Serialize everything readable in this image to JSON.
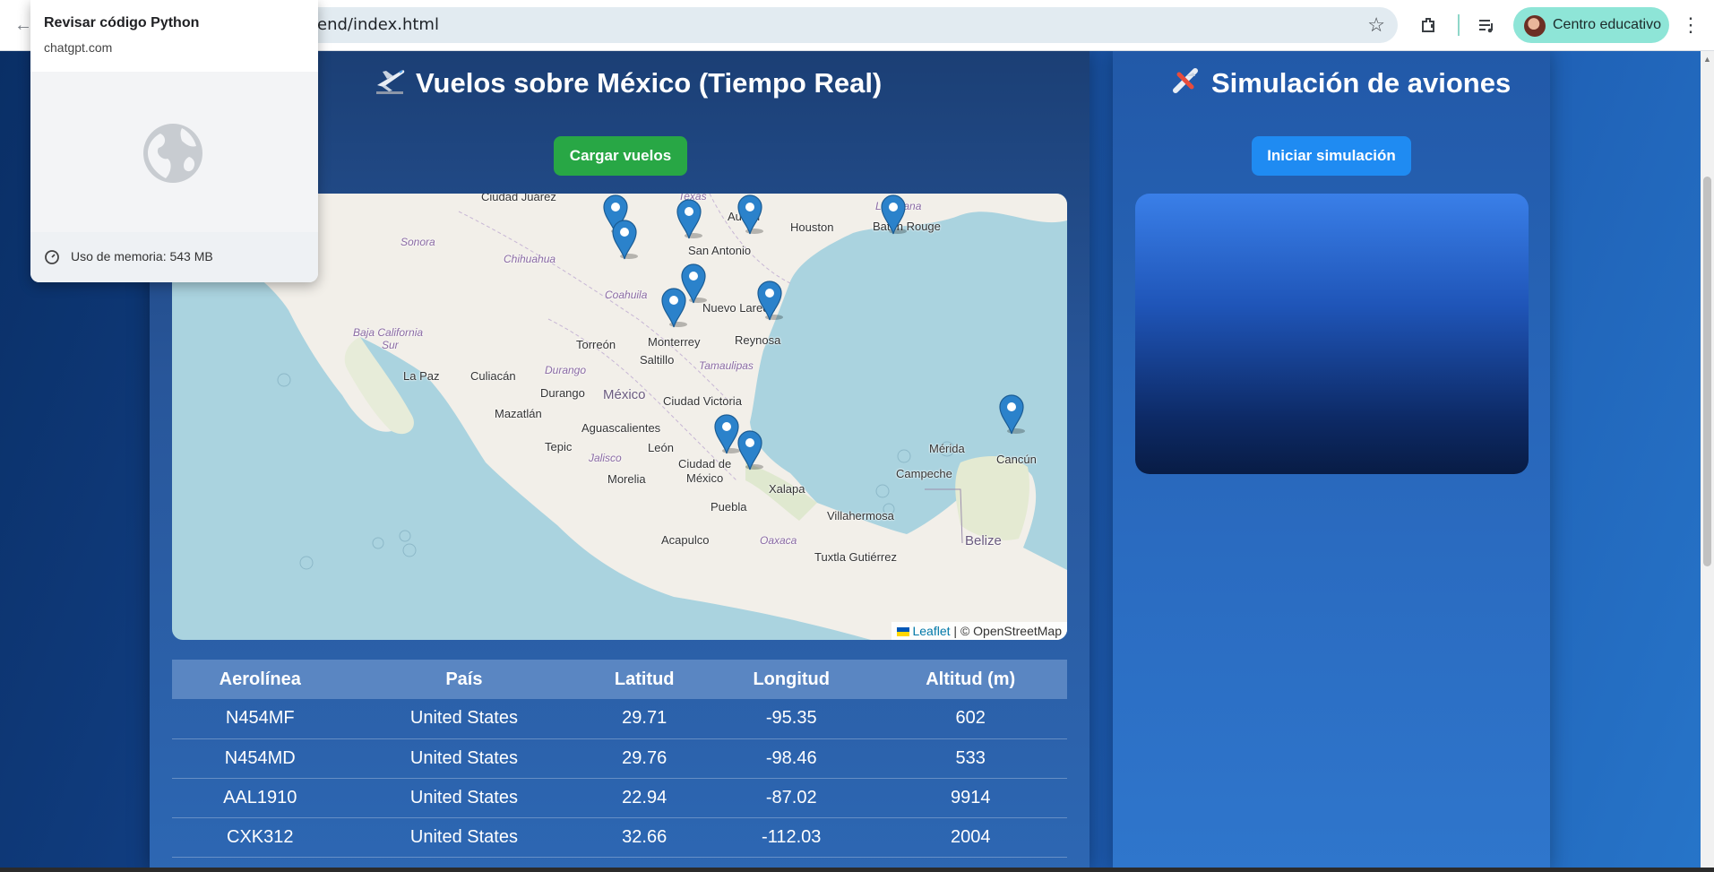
{
  "browser": {
    "url_visible": "end/index.html",
    "profile_label": "Centro educativo",
    "icons": [
      "back-arrow-icon",
      "star-icon",
      "extensions-icon",
      "media-queue-icon",
      "kebab-menu-icon"
    ]
  },
  "popup": {
    "title": "Revisar código Python",
    "host": "chatgpt.com",
    "memory": "Uso de memoria: 543 MB"
  },
  "left_panel": {
    "title": "Vuelos sobre México (Tiempo Real)",
    "load_button": "Cargar vuelos"
  },
  "right_panel": {
    "title": "Simulación de aviones",
    "start_button": "Iniciar simulación"
  },
  "map": {
    "labels": {
      "ciudad_juarez": "Ciudad Juárez",
      "texas": "Texas",
      "austin": "Austin",
      "houston": "Houston",
      "louisiana": "Louisiana",
      "baton_rouge": "Baton Rouge",
      "sonora": "Sonora",
      "chihuahua": "Chihuahua",
      "san_antonio": "San Antonio",
      "nuevo_laredo": "Nuevo Laredo",
      "coahuila": "Coahuila",
      "baja_california": "Baja California",
      "sur": "Sur",
      "torreon": "Torreón",
      "monterrey": "Monterrey",
      "reynosa": "Reynosa",
      "la_paz": "La Paz",
      "culiacan": "Culiacán",
      "durango_state": "Durango",
      "tamaulipas": "Tamaulipas",
      "saltillo": "Saltillo",
      "durango": "Durango",
      "mexico": "México",
      "ciudad_victoria": "Ciudad Victoria",
      "mazatlan": "Mazatlán",
      "aguascalientes": "Aguascalientes",
      "merida": "Mérida",
      "cancun": "Cancún",
      "tepic": "Tepic",
      "jalisco": "Jalisco",
      "leon": "León",
      "ciudad_de": "Ciudad de",
      "mexico_city": "México",
      "campeche": "Campeche",
      "morelia": "Morelia",
      "xalapa": "Xalapa",
      "puebla": "Puebla",
      "villahermosa": "Villahermosa",
      "acapulco": "Acapulco",
      "oaxaca": "Oaxaca",
      "belize": "Belize",
      "tuxtla": "Tuxtla Gutiérrez"
    },
    "attribution_link": "Leaflet",
    "attribution_text": "| © OpenStreetMap",
    "marker_icon": "map-pin-icon",
    "marker_count": 11
  },
  "table": {
    "headers": [
      "Aerolínea",
      "País",
      "Latitud",
      "Longitud",
      "Altitud (m)"
    ],
    "rows": [
      [
        "N454MF",
        "United States",
        "29.71",
        "-95.35",
        "602"
      ],
      [
        "N454MD",
        "United States",
        "29.76",
        "-98.46",
        "533"
      ],
      [
        "AAL1910",
        "United States",
        "22.94",
        "-87.02",
        "9914"
      ],
      [
        "CXK312",
        "United States",
        "32.66",
        "-112.03",
        "2004"
      ]
    ]
  }
}
